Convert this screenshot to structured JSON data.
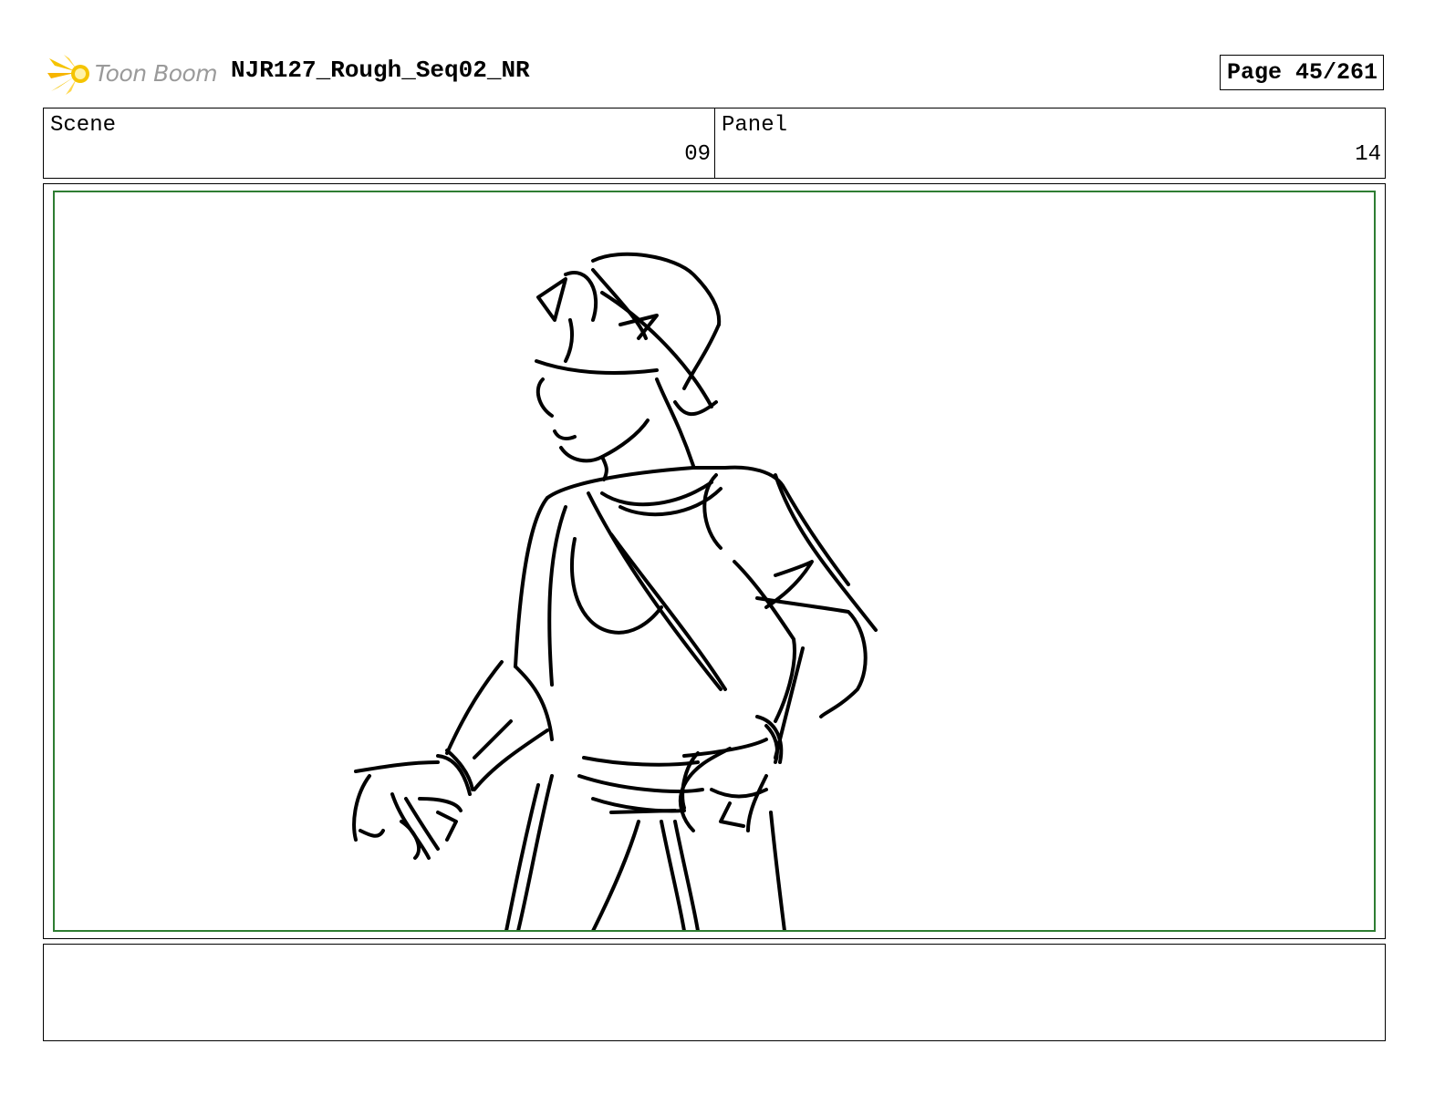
{
  "header": {
    "logo_text": "Toon Boom",
    "title": "NJR127_Rough_Seq02_NR",
    "page_label": "Page",
    "page_number": "45/261"
  },
  "info": {
    "scene_label": "Scene",
    "scene_value": "09",
    "panel_label": "Panel",
    "panel_value": "14"
  },
  "colors": {
    "safe_frame": "#2e7d32",
    "logo_accent": "#f5c400"
  },
  "icons": [
    "toon-boom-logo-icon"
  ],
  "notes": ""
}
